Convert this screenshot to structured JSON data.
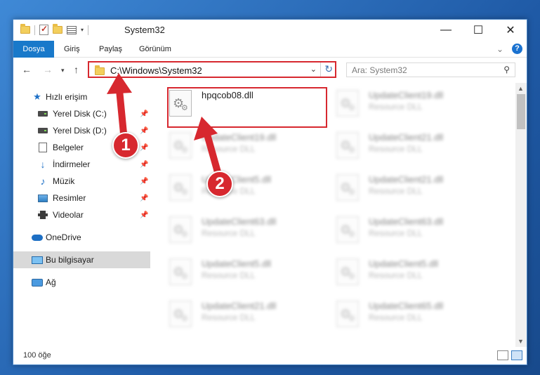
{
  "window": {
    "title": "System32"
  },
  "controls": {
    "minimize": "—",
    "maximize": "☐",
    "close": "✕"
  },
  "ribbon": {
    "tabs": [
      "Dosya",
      "Giriş",
      "Paylaş",
      "Görünüm"
    ]
  },
  "address": {
    "path": "C:\\Windows\\System32"
  },
  "search": {
    "placeholder": "Ara: System32"
  },
  "sidebar": {
    "items": [
      {
        "label": "Hızlı erişim"
      },
      {
        "label": "Yerel Disk (C:)"
      },
      {
        "label": "Yerel Disk (D:)"
      },
      {
        "label": "Belgeler"
      },
      {
        "label": "İndirmeler"
      },
      {
        "label": "Müzik"
      },
      {
        "label": "Resimler"
      },
      {
        "label": "Videolar"
      },
      {
        "label": "OneDrive"
      },
      {
        "label": "Bu bilgisayar"
      },
      {
        "label": "Ağ"
      }
    ]
  },
  "files": [
    {
      "name": "hpqcob08.dll",
      "type": ""
    },
    {
      "name": "UpdateClient19.dll",
      "type": "Resource DLL"
    },
    {
      "name": "UpdateClient19.dll",
      "type": "Resource DLL"
    },
    {
      "name": "UpdateClient21.dll",
      "type": "Resource DLL"
    },
    {
      "name": "UpdateClient5.dll",
      "type": "Resource DLL"
    },
    {
      "name": "UpdateClient21.dll",
      "type": "Resource DLL"
    },
    {
      "name": "UpdateClient63.dll",
      "type": "Resource DLL"
    },
    {
      "name": "UpdateClient63.dll",
      "type": "Resource DLL"
    },
    {
      "name": "UpdateClient5.dll",
      "type": "Resource DLL"
    },
    {
      "name": "UpdateClient5.dll",
      "type": "Resource DLL"
    },
    {
      "name": "UpdateClient21.dll",
      "type": "Resource DLL"
    },
    {
      "name": "UpdateClient65.dll",
      "type": "Resource DLL"
    }
  ],
  "status": {
    "count": "100 öğe"
  },
  "callouts": {
    "one": "1",
    "two": "2"
  },
  "colors": {
    "accent": "#1979ca",
    "highlight": "#d7282f"
  }
}
